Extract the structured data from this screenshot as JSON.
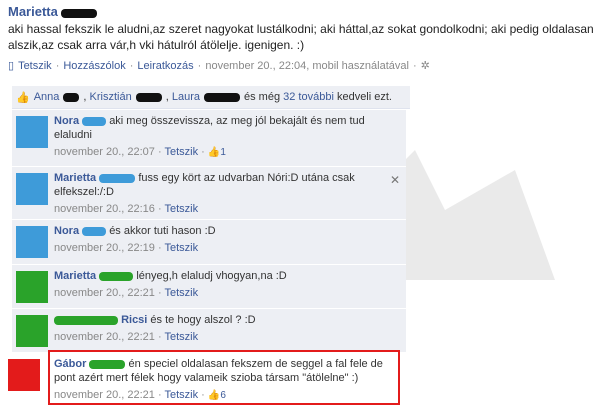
{
  "post": {
    "author": "Marietta",
    "text": "aki hassal fekszik le aludni,az szeret nagyokat lustálkodni; aki háttal,az sokat gondolkodni; aki pedig oldalasan alszik,az csak arra vár,h vki hátulról átölelje. igenigen. :)",
    "actions": {
      "like": "Tetszik",
      "comment": "Hozzászólok",
      "unsubscribe": "Leiratkozás"
    },
    "sep": "·",
    "timestamp": "november 20., 22:04, mobil használatával"
  },
  "likes": {
    "name1": "Anna",
    "name2": "Krisztián",
    "name3": "Laura",
    "middle": "és még",
    "more_link": "32 további",
    "suffix": "kedveli ezt."
  },
  "comments": [
    {
      "name": "Nora",
      "text": "aki meg összevissza, az meg jól bekajált és nem tud elaludni",
      "time": "november 20., 22:07",
      "like": "Tetszik",
      "count": "1",
      "avatar": "#3e9bd9"
    },
    {
      "name": "Marietta",
      "text": "fuss egy kört az udvarban Nóri:D utána csak elfekszel:/:D",
      "time": "november 20., 22:16",
      "like": "Tetszik",
      "avatar": "#3e9bd9"
    },
    {
      "name": "Nora",
      "text": "és akkor tuti hason :D",
      "time": "november 20., 22:19",
      "like": "Tetszik",
      "avatar": "#3e9bd9"
    },
    {
      "name": "Marietta",
      "text": "lényeg,h elaludj vhogyan,na :D",
      "time": "november 20., 22:21",
      "like": "Tetszik",
      "avatar": "#2aa32a"
    },
    {
      "name": "Ricsi",
      "text": "és te hogy alszol ? :D",
      "time": "november 20., 22:21",
      "like": "Tetszik",
      "avatar": "#2aa32a"
    },
    {
      "name": "Gábor",
      "text": "én speciel oldalasan fekszem de seggel a fal fele de pont azért mert félek hogy valameik szioba társam \"átölelne\" :)",
      "time": "november 20., 22:21",
      "like": "Tetszik",
      "count": "6",
      "avatar": "#e31b1b"
    }
  ],
  "colors": {
    "link": "#3b5998",
    "panel": "#edeff4",
    "highlight": "#e31b1b"
  }
}
